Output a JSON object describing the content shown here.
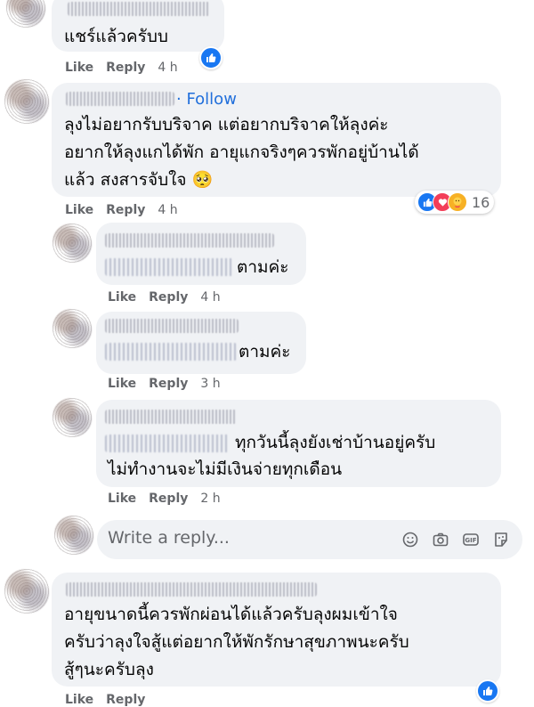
{
  "actions": {
    "like": "Like",
    "reply": "Reply"
  },
  "comments": [
    {
      "text_lines": [
        "แชร์แล้วครับบ"
      ],
      "time": "4 h"
    },
    {
      "follow": "Follow",
      "text_lines": [
        "ลุงไม่อยากรับบริจาค แต่อยากบริจาคให้ลุงค่ะ",
        "อยากให้ลุงแกได้พัก อายุแกจริงๆควรพักอยู่บ้านได้",
        "แล้ว สงสารจับใจ 🥺"
      ],
      "time": "4 h",
      "reaction_count": "16"
    },
    {
      "text_lines": [
        "ตามค่ะ"
      ],
      "time": "4 h"
    },
    {
      "text_lines": [
        "ตามค่ะ"
      ],
      "time": "3 h"
    },
    {
      "text_lines": [
        "ทุกวันนี้ลุงยังเช่าบ้านอยู่ครับ",
        "ไม่ทำงานจะไม่มีเงินจ่ายทุกเดือน"
      ],
      "time": "2 h"
    },
    {
      "text_lines": [
        "อายุขนาดนี้ควรพักผ่อนได้แล้วครับลุงผมเข้าใจ",
        "ครับว่าลุงใจสู้แต่อยากให้พักรักษาสุขภาพนะครับ",
        "สู้ๆนะครับลุง"
      ]
    }
  ],
  "reply_box": {
    "placeholder": "Write a reply...",
    "icons": [
      "emoji-icon",
      "camera-icon",
      "gif-icon",
      "sticker-icon"
    ]
  },
  "colors": {
    "bubble": "#f0f2f5",
    "secondary_text": "#65676b",
    "link": "#216fdb",
    "like_blue": "#1877f2"
  }
}
